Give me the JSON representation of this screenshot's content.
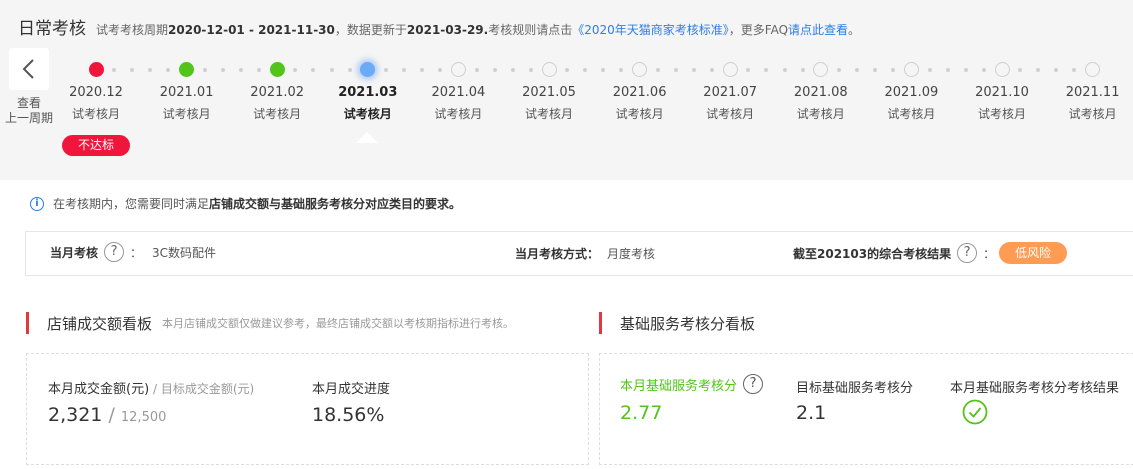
{
  "header": {
    "title": "日常考核",
    "meta_prefix": "试考考核周期",
    "period": "2020-12-01 - 2021-11-30",
    "meta_mid": "，数据更新于",
    "update_date": "2021-03-29.",
    "meta_rule": "考核规则请点击",
    "rule_link": "《2020年天猫商家考核标准》",
    "meta_faq": "，更多FAQ",
    "faq_link": "请点此查看",
    "meta_end": "。"
  },
  "prev": {
    "label_1": "查看",
    "label_2": "上一周期"
  },
  "timeline": {
    "months": [
      {
        "date": "2020.12",
        "sub": "试考核月",
        "status": "red"
      },
      {
        "date": "2021.01",
        "sub": "试考核月",
        "status": "green"
      },
      {
        "date": "2021.02",
        "sub": "试考核月",
        "status": "green"
      },
      {
        "date": "2021.03",
        "sub": "试考核月",
        "status": "current"
      },
      {
        "date": "2021.04",
        "sub": "试考核月",
        "status": "empty"
      },
      {
        "date": "2021.05",
        "sub": "试考核月",
        "status": "empty"
      },
      {
        "date": "2021.06",
        "sub": "试考核月",
        "status": "empty"
      },
      {
        "date": "2021.07",
        "sub": "试考核月",
        "status": "empty"
      },
      {
        "date": "2021.08",
        "sub": "试考核月",
        "status": "empty"
      },
      {
        "date": "2021.09",
        "sub": "试考核月",
        "status": "empty"
      },
      {
        "date": "2021.10",
        "sub": "试考核月",
        "status": "empty"
      },
      {
        "date": "2021.11",
        "sub": "试考核月",
        "status": "empty"
      }
    ],
    "fail_badge": "不达标"
  },
  "info": {
    "prefix": "在考核期内，您需要同时满足",
    "bold": "店铺成交额与基础服务考核分对应类目的要求。"
  },
  "summary": {
    "month_label": "当月考核",
    "month_colon": "：",
    "category": "3C数码配件",
    "method_label": "当月考核方式：",
    "method": "月度考核",
    "result_label": "截至202103的综合考核结果",
    "result_colon": "：",
    "risk": "低风险"
  },
  "sections": {
    "sales": {
      "title": "店铺成交额看板",
      "hint": "本月店铺成交额仅做建议参考，最终店铺成交额以考核期指标进行考核。"
    },
    "service": {
      "title": "基础服务考核分看板"
    }
  },
  "sales_card": {
    "amount_label": "本月成交金额(元)",
    "sep": " / ",
    "target_label": "目标成交金额(元)",
    "amount": "2,321",
    "target": "12,500",
    "progress_label": "本月成交进度",
    "progress": "18.56%"
  },
  "service_card": {
    "score_label": "本月基础服务考核分",
    "score": "2.77",
    "target_label": "目标基础服务考核分",
    "target": "2.1",
    "result_label": "本月基础服务考核分考核结果"
  },
  "colors": {
    "accent_red": "#f0163b",
    "pass_green": "#52c41a",
    "current_blue": "#6aaaf6",
    "link_blue": "#2a7ee8",
    "risk_orange": "#ff9b52"
  }
}
